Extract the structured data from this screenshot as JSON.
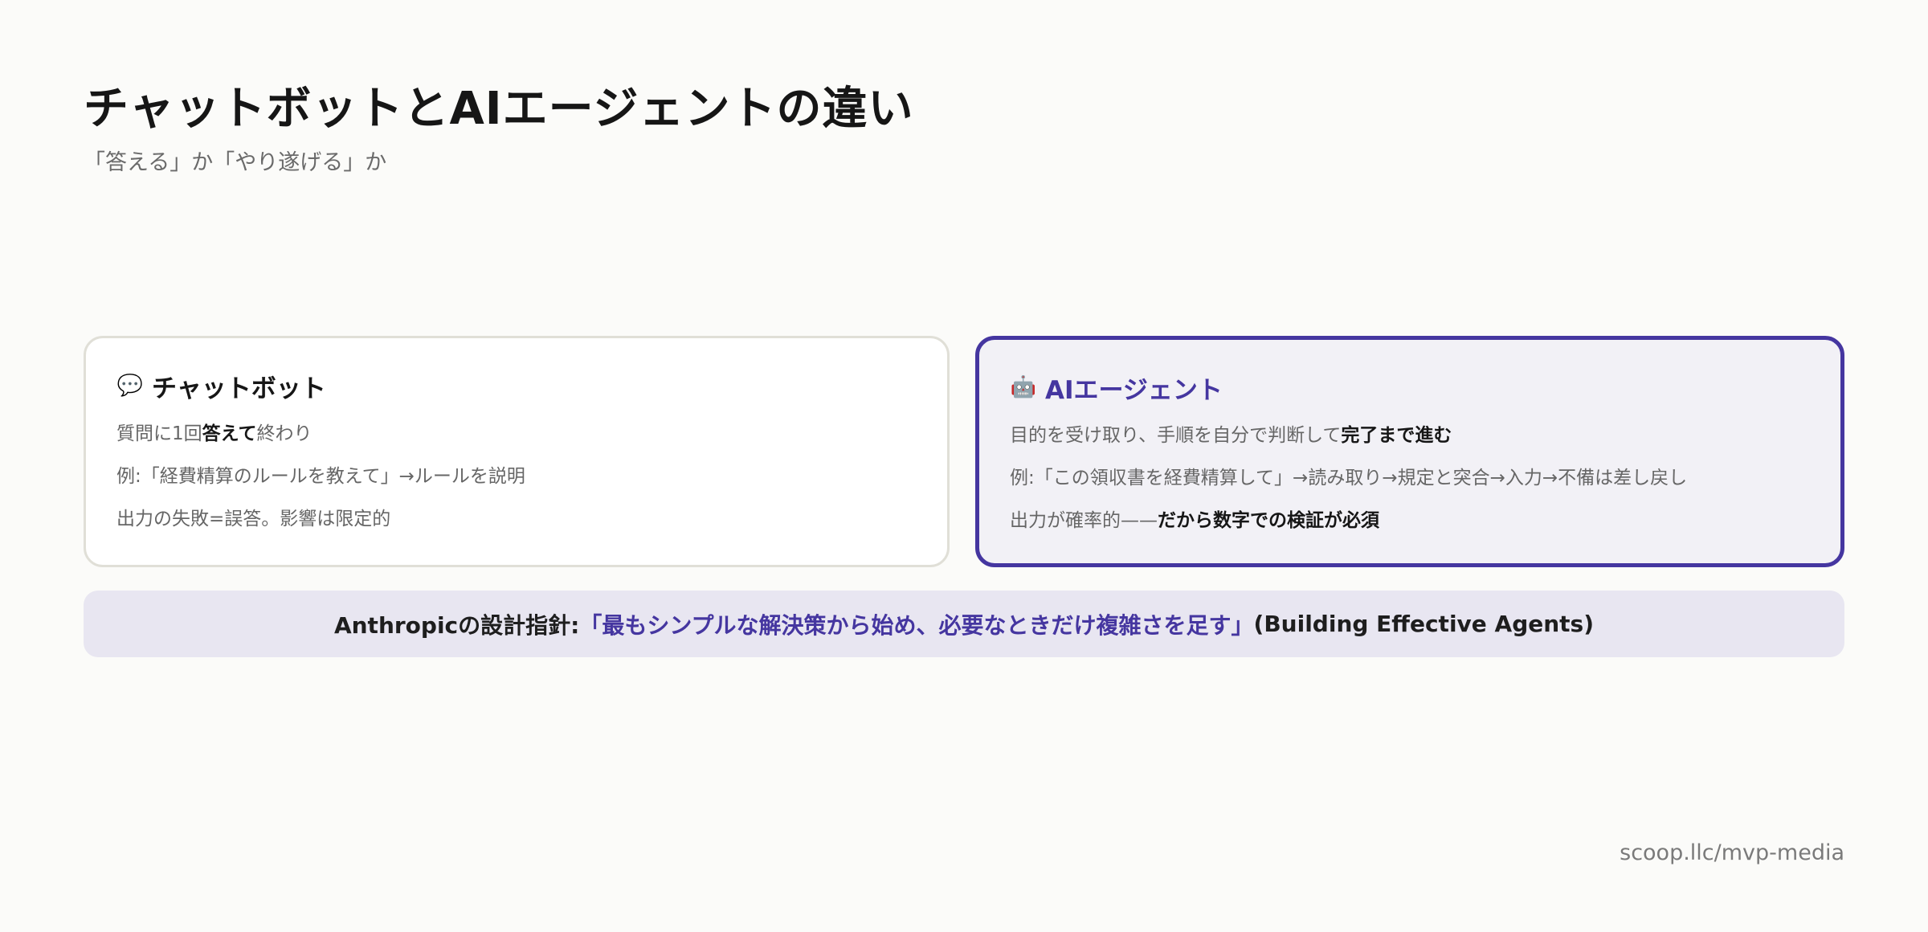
{
  "header": {
    "title": "チャットボットとAIエージェントの違い",
    "subtitle": "「答える」か「やり遂げる」か"
  },
  "chatbot_card": {
    "icon": "speech-bubble-icon",
    "icon_glyph": "💬",
    "title": "チャットボット",
    "line1_pre": "質問に1回",
    "line1_bold": "答えて",
    "line1_post": "終わり",
    "line2": "例:「経費精算のルールを教えて」→ルールを説明",
    "line3": "出力の失敗=誤答。影響は限定的"
  },
  "agent_card": {
    "icon": "robot-icon",
    "icon_glyph": "🤖",
    "title": "AIエージェント",
    "line1_pre": "目的を受け取り、手順を自分で判断して",
    "line1_bold": "完了まで進む",
    "line2": "例:「この領収書を経費精算して」→読み取り→規定と突合→入力→不備は差し戻し",
    "line3_pre": "出力が確率的——",
    "line3_bold": "だから数字での検証が必須"
  },
  "banner": {
    "prefix": "Anthropicの設計指針:",
    "quote": "「最もシンプルな解決策から始め、必要なときだけ複雑さを足す」",
    "suffix": "(Building Effective Agents)"
  },
  "footer": {
    "source": "scoop.llc/mvp-media"
  },
  "colors": {
    "accent": "#4536a0",
    "background": "#fbfbf9",
    "banner_bg": "#e8e6f1",
    "agent_card_bg": "#f2f1f6"
  }
}
